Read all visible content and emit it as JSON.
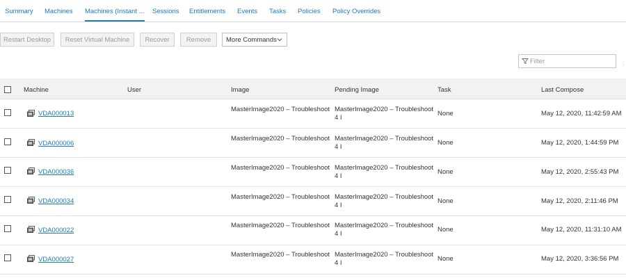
{
  "tabs": [
    {
      "label": "Summary",
      "active": false
    },
    {
      "label": "Machines",
      "active": false
    },
    {
      "label": "Machines (Instant ...",
      "active": true
    },
    {
      "label": "Sessions",
      "active": false
    },
    {
      "label": "Entitlements",
      "active": false
    },
    {
      "label": "Events",
      "active": false
    },
    {
      "label": "Tasks",
      "active": false
    },
    {
      "label": "Policies",
      "active": false
    },
    {
      "label": "Policy Overrides",
      "active": false
    }
  ],
  "toolbar": {
    "restart_desktop": "Restart Desktop",
    "reset_vm": "Reset Virtual Machine",
    "recover": "Recover",
    "remove": "Remove",
    "more_commands": "More Commands"
  },
  "filter": {
    "placeholder": "Filter",
    "value": ""
  },
  "table": {
    "columns": {
      "machine": "Machine",
      "user": "User",
      "image": "Image",
      "pending_image": "Pending Image",
      "task": "Task",
      "last_compose": "Last Compose"
    },
    "rows": [
      {
        "machine": "VDA000013",
        "user": "",
        "image": "MasterImage2020 – Troubleshoot",
        "pending_image": "MasterImage2020 – Troubleshoot",
        "pending_suffix": "4 I",
        "task": "None",
        "last_compose": "May 12, 2020, 11:42:59 AM"
      },
      {
        "machine": "VDA000006",
        "user": "",
        "image": "MasterImage2020 – Troubleshoot",
        "pending_image": "MasterImage2020 – Troubleshoot",
        "pending_suffix": "4 I",
        "task": "None",
        "last_compose": "May 12, 2020, 1:44:59 PM"
      },
      {
        "machine": "VDA000036",
        "user": "",
        "image": "MasterImage2020 – Troubleshoot",
        "pending_image": "MasterImage2020 – Troubleshoot",
        "pending_suffix": "4 I",
        "task": "None",
        "last_compose": "May 12, 2020, 2:55:43 PM"
      },
      {
        "machine": "VDA000034",
        "user": "",
        "image": "MasterImage2020 – Troubleshoot",
        "pending_image": "MasterImage2020 – Troubleshoot",
        "pending_suffix": "4 I",
        "task": "None",
        "last_compose": "May 12, 2020, 2:11:46 PM"
      },
      {
        "machine": "VDA000022",
        "user": "",
        "image": "MasterImage2020 – Troubleshoot",
        "pending_image": "MasterImage2020 – Troubleshoot",
        "pending_suffix": "4 I",
        "task": "None",
        "last_compose": "May 12, 2020, 11:31:10 AM"
      },
      {
        "machine": "VDA000027",
        "user": "",
        "image": "MasterImage2020 – Troubleshoot",
        "pending_image": "MasterImage2020 – Troubleshoot",
        "pending_suffix": "4 I",
        "task": "None",
        "last_compose": "May 12, 2020, 3:36:56 PM"
      }
    ]
  },
  "icons": {
    "filter": "filter-icon",
    "machine": "vm-machine-icon",
    "dropdown": "chevron-down-icon"
  },
  "colors": {
    "accent": "#1a7bbf",
    "header_bg": "#f2f2f2",
    "disabled_text": "#9a9a9a"
  }
}
